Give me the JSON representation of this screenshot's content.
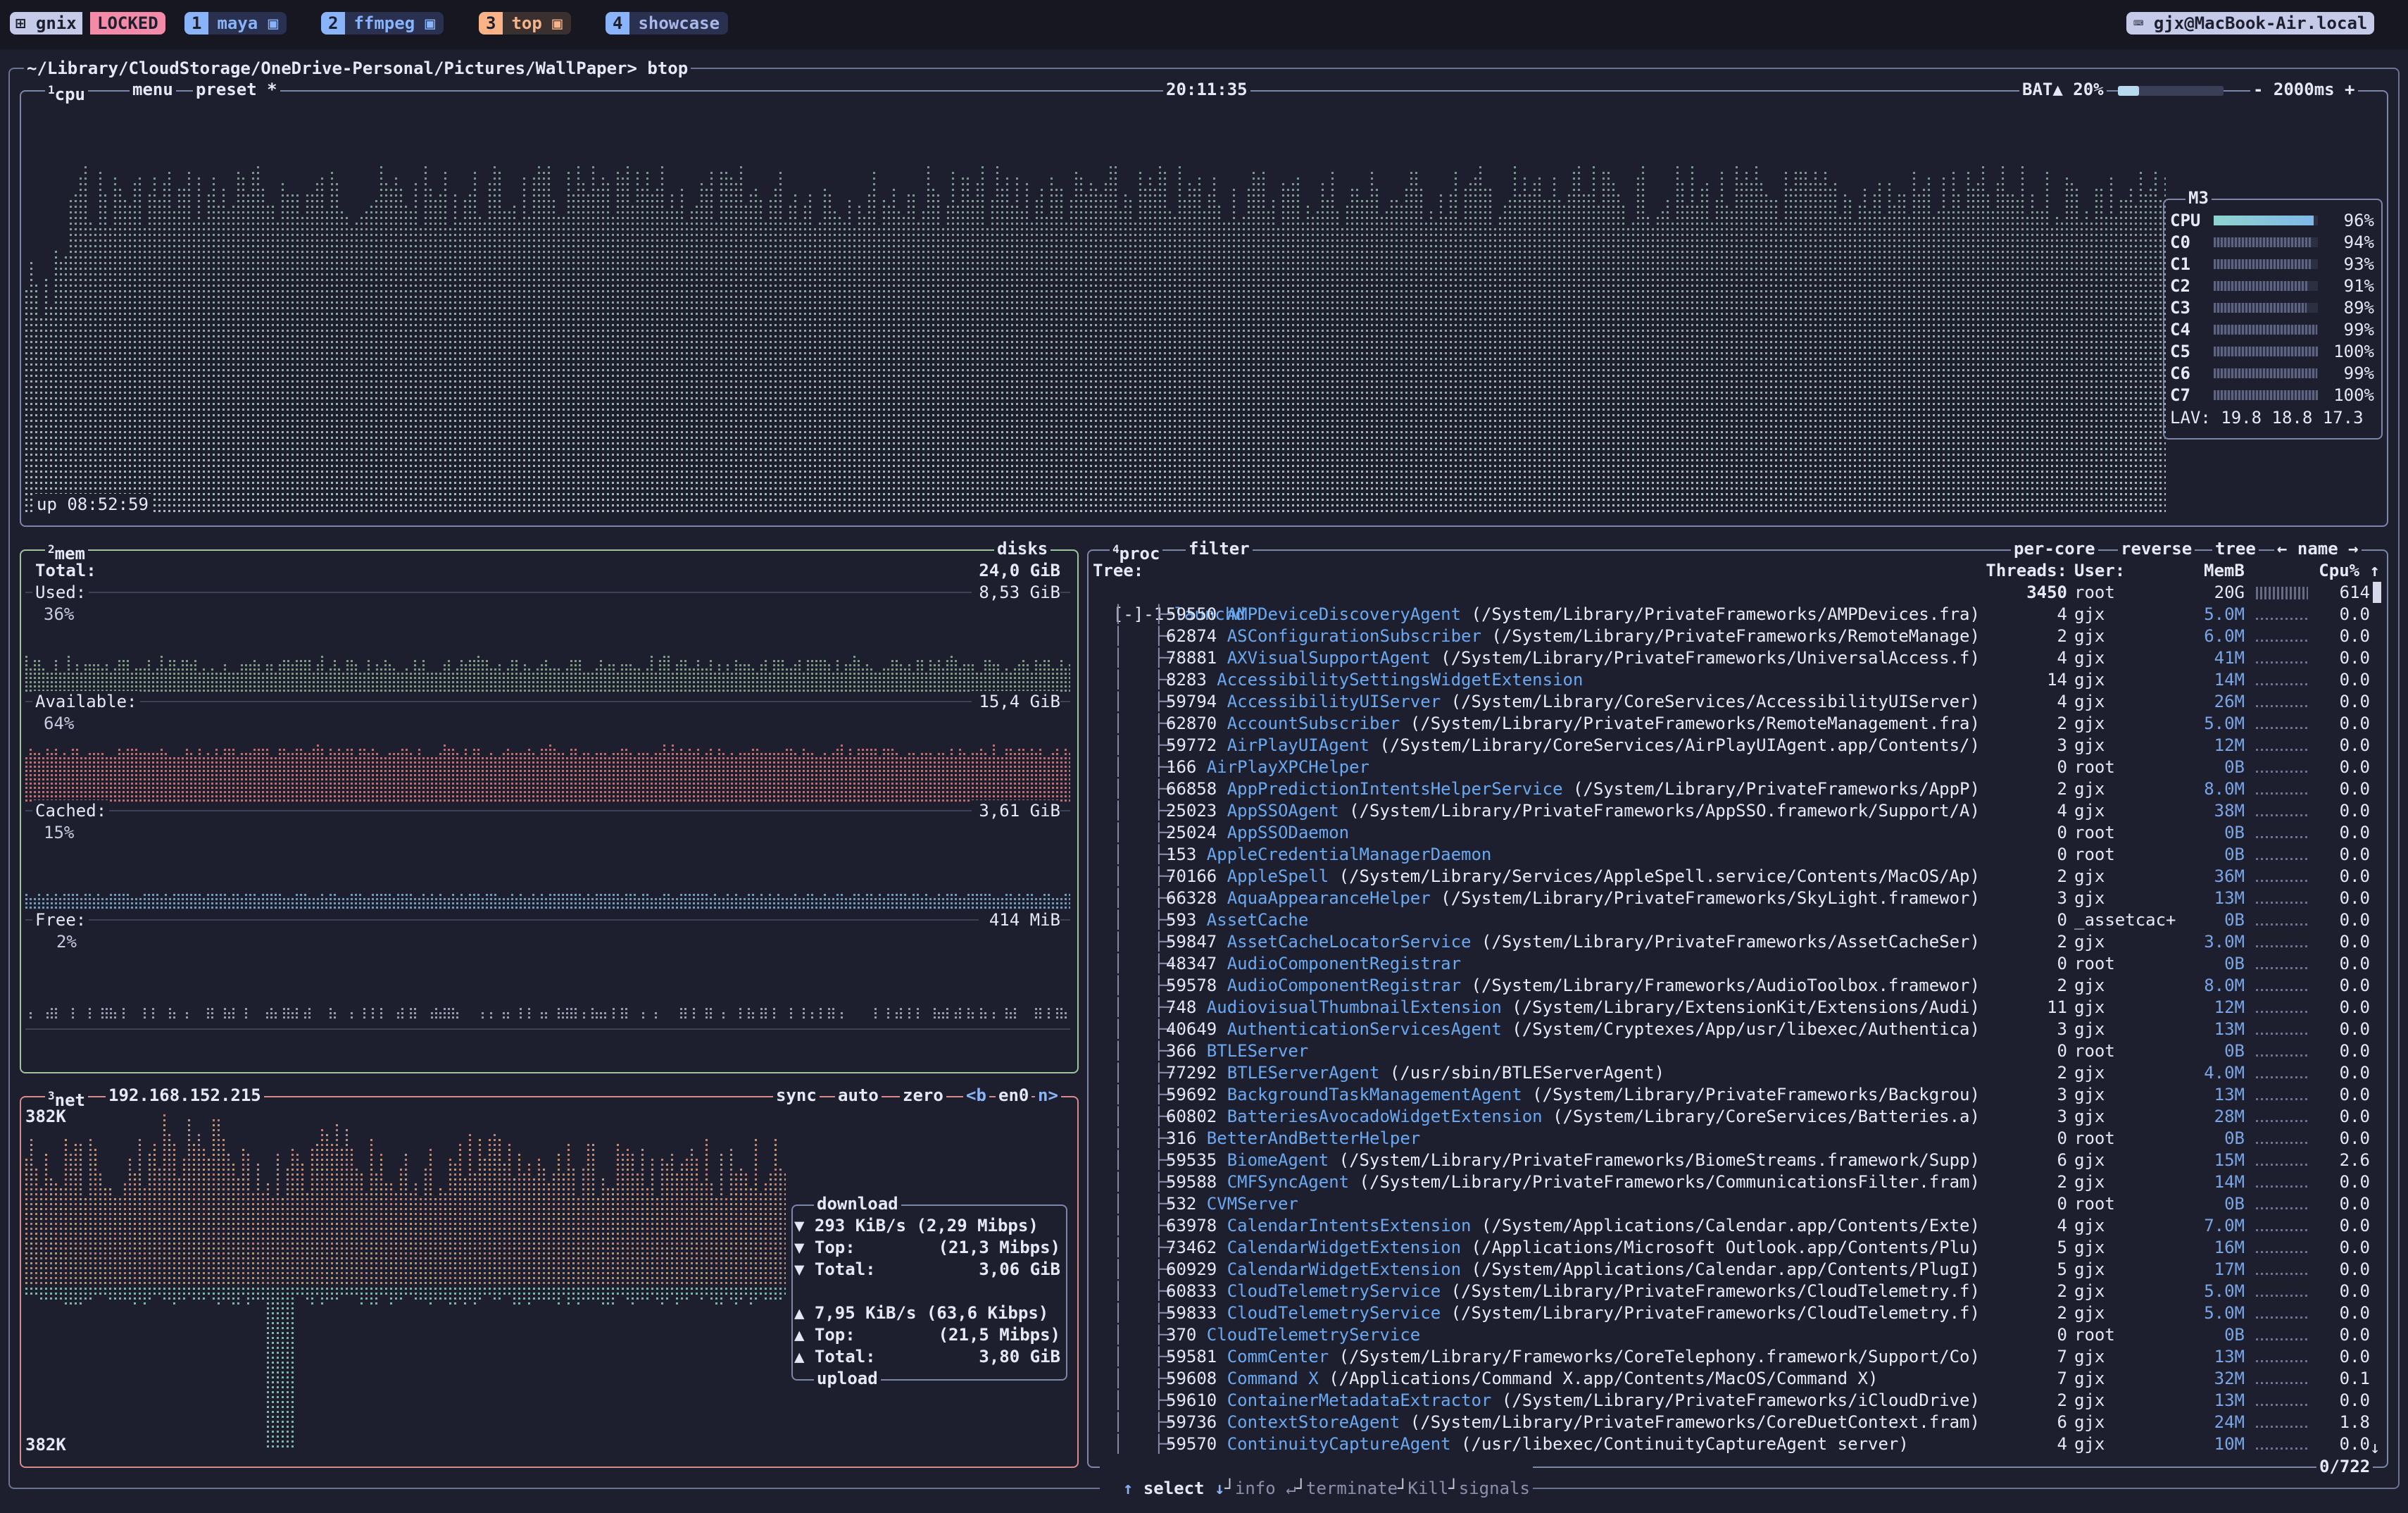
{
  "topbar": {
    "session_icon": "grid-icon",
    "session_name": "gnix",
    "session_status": "LOCKED",
    "windows": [
      {
        "index": "1",
        "name": "maya",
        "color": "#89b4fa"
      },
      {
        "index": "2",
        "name": "ffmpeg",
        "color": "#89b4fa"
      },
      {
        "index": "3",
        "name": "top",
        "color": "#fab387"
      },
      {
        "index": "4",
        "name": "showcase",
        "color": "#89b4fa"
      }
    ],
    "host": "gjx@MacBook-Air.local"
  },
  "prompt": "~/Library/CloudStorage/OneDrive-Personal/Pictures/WallPaper> btop",
  "cpu": {
    "pane_number": "1",
    "title": "cpu",
    "menu": "menu",
    "preset": "preset *",
    "clock": "20:11:35",
    "battery_label": "BAT▲ 20%",
    "battery_percent": 20,
    "refresh": "- 2000ms +",
    "uptime": "up 08:52:59",
    "model": "M3",
    "cores": [
      {
        "label": "CPU",
        "value": "96%",
        "level": 0.96
      },
      {
        "label": "C0",
        "value": "94%",
        "level": 0.94
      },
      {
        "label": "C1",
        "value": "93%",
        "level": 0.93
      },
      {
        "label": "C2",
        "value": "91%",
        "level": 0.91
      },
      {
        "label": "C3",
        "value": "89%",
        "level": 0.89
      },
      {
        "label": "C4",
        "value": "99%",
        "level": 0.99
      },
      {
        "label": "C5",
        "value": "100%",
        "level": 1.0
      },
      {
        "label": "C6",
        "value": "99%",
        "level": 0.99
      },
      {
        "label": "C7",
        "value": "100%",
        "level": 1.0
      }
    ],
    "load_avg": "LAV: 19.8 18.8 17.3"
  },
  "mem": {
    "pane_number": "2",
    "title": "mem",
    "disks": "disks",
    "total_label": "Total:",
    "total_value": "24,0 GiB",
    "used_label": "Used:",
    "used_value": "8,53 GiB",
    "used_pct": "36%",
    "available_label": "Available:",
    "available_value": "15,4 GiB",
    "available_pct": "64%",
    "cached_label": "Cached:",
    "cached_value": "3,61 GiB",
    "cached_pct": "15%",
    "free_label": "Free:",
    "free_value": "414 MiB",
    "free_pct": "2%"
  },
  "net": {
    "pane_number": "3",
    "title": "net",
    "ip": "192.168.152.215",
    "sync": "sync",
    "auto": "auto",
    "zero": "zero",
    "prev": "<b",
    "iface": "en0",
    "next": "n>",
    "scale_top": "382K",
    "scale_bottom": "382K",
    "download_title": "download",
    "download_rate": "▼ 293 KiB/s (2,29 Mibps)",
    "download_top_label": "▼ Top:",
    "download_top": "(21,3 Mibps)",
    "download_total_label": "▼ Total:",
    "download_total": "3,06 GiB",
    "upload_rate": "▲ 7,95 KiB/s (63,6 Kibps)",
    "upload_top_label": "▲ Top:",
    "upload_top": "(21,5 Mibps)",
    "upload_total_label": "▲ Total:",
    "upload_total": "3,80 GiB",
    "upload_title": "upload"
  },
  "proc": {
    "pane_number": "4",
    "title": "proc",
    "filter": "filter",
    "per_core": "per-core",
    "reverse": "reverse",
    "tree": "tree",
    "sort": "← name →",
    "col_tree": "Tree:",
    "col_threads": "Threads:",
    "col_user": "User:",
    "col_mem": "MemB",
    "col_cpu": "Cpu% ↑",
    "root": {
      "prefix": "[-]-1",
      "name": "launchd",
      "threads": "3450",
      "user": "root",
      "mem": "20G",
      "cpu": "614"
    },
    "rows": [
      {
        "pid": "59550",
        "name": "AMPDeviceDiscoveryAgent",
        "cmd": " (/System/Library/PrivateFrameworks/AMPDevices.fra)",
        "threads": "4",
        "user": "gjx",
        "mem": "5.0M",
        "cpu": "0.0"
      },
      {
        "pid": "62874",
        "name": "ASConfigurationSubscriber",
        "cmd": " (/System/Library/PrivateFrameworks/RemoteManage)",
        "threads": "2",
        "user": "gjx",
        "mem": "6.0M",
        "cpu": "0.0"
      },
      {
        "pid": "78881",
        "name": "AXVisualSupportAgent",
        "cmd": " (/System/Library/PrivateFrameworks/UniversalAccess.f)",
        "threads": "4",
        "user": "gjx",
        "mem": "41M",
        "cpu": "0.0"
      },
      {
        "pid": "8283",
        "name": "AccessibilitySettingsWidgetExtension",
        "cmd": "",
        "threads": "14",
        "user": "gjx",
        "mem": "14M",
        "cpu": "0.0"
      },
      {
        "pid": "59794",
        "name": "AccessibilityUIServer",
        "cmd": " (/System/Library/CoreServices/AccessibilityUIServer)",
        "threads": "4",
        "user": "gjx",
        "mem": "26M",
        "cpu": "0.0"
      },
      {
        "pid": "62870",
        "name": "AccountSubscriber",
        "cmd": " (/System/Library/PrivateFrameworks/RemoteManagement.fra)",
        "threads": "2",
        "user": "gjx",
        "mem": "5.0M",
        "cpu": "0.0"
      },
      {
        "pid": "59772",
        "name": "AirPlayUIAgent",
        "cmd": " (/System/Library/CoreServices/AirPlayUIAgent.app/Contents/)",
        "threads": "3",
        "user": "gjx",
        "mem": "12M",
        "cpu": "0.0"
      },
      {
        "pid": "166",
        "name": "AirPlayXPCHelper",
        "cmd": "",
        "threads": "0",
        "user": "root",
        "mem": "0B",
        "cpu": "0.0"
      },
      {
        "pid": "66858",
        "name": "AppPredictionIntentsHelperService",
        "cmd": " (/System/Library/PrivateFrameworks/AppP)",
        "threads": "2",
        "user": "gjx",
        "mem": "8.0M",
        "cpu": "0.0"
      },
      {
        "pid": "25023",
        "name": "AppSSOAgent",
        "cmd": " (/System/Library/PrivateFrameworks/AppSSO.framework/Support/A)",
        "threads": "4",
        "user": "gjx",
        "mem": "38M",
        "cpu": "0.0"
      },
      {
        "pid": "25024",
        "name": "AppSSODaemon",
        "cmd": "",
        "threads": "0",
        "user": "root",
        "mem": "0B",
        "cpu": "0.0"
      },
      {
        "pid": "153",
        "name": "AppleCredentialManagerDaemon",
        "cmd": "",
        "threads": "0",
        "user": "root",
        "mem": "0B",
        "cpu": "0.0"
      },
      {
        "pid": "70166",
        "name": "AppleSpell",
        "cmd": " (/System/Library/Services/AppleSpell.service/Contents/MacOS/Ap)",
        "threads": "2",
        "user": "gjx",
        "mem": "36M",
        "cpu": "0.0"
      },
      {
        "pid": "66328",
        "name": "AquaAppearanceHelper",
        "cmd": " (/System/Library/PrivateFrameworks/SkyLight.framewor)",
        "threads": "3",
        "user": "gjx",
        "mem": "13M",
        "cpu": "0.0"
      },
      {
        "pid": "593",
        "name": "AssetCache",
        "cmd": "",
        "threads": "0",
        "user": "_assetcac+",
        "mem": "0B",
        "cpu": "0.0"
      },
      {
        "pid": "59847",
        "name": "AssetCacheLocatorService",
        "cmd": " (/System/Library/PrivateFrameworks/AssetCacheSer)",
        "threads": "2",
        "user": "gjx",
        "mem": "3.0M",
        "cpu": "0.0"
      },
      {
        "pid": "48347",
        "name": "AudioComponentRegistrar",
        "cmd": "",
        "threads": "0",
        "user": "root",
        "mem": "0B",
        "cpu": "0.0"
      },
      {
        "pid": "59578",
        "name": "AudioComponentRegistrar",
        "cmd": " (/System/Library/Frameworks/AudioToolbox.framewor)",
        "threads": "2",
        "user": "gjx",
        "mem": "8.0M",
        "cpu": "0.0"
      },
      {
        "pid": "748",
        "name": "AudiovisualThumbnailExtension",
        "cmd": " (/System/Library/ExtensionKit/Extensions/Audi)",
        "threads": "11",
        "user": "gjx",
        "mem": "12M",
        "cpu": "0.0"
      },
      {
        "pid": "40649",
        "name": "AuthenticationServicesAgent",
        "cmd": " (/System/Cryptexes/App/usr/libexec/Authentica)",
        "threads": "3",
        "user": "gjx",
        "mem": "13M",
        "cpu": "0.0"
      },
      {
        "pid": "366",
        "name": "BTLEServer",
        "cmd": "",
        "threads": "0",
        "user": "root",
        "mem": "0B",
        "cpu": "0.0"
      },
      {
        "pid": "77292",
        "name": "BTLEServerAgent",
        "cmd": " (/usr/sbin/BTLEServerAgent)",
        "threads": "2",
        "user": "gjx",
        "mem": "4.0M",
        "cpu": "0.0"
      },
      {
        "pid": "59692",
        "name": "BackgroundTaskManagementAgent",
        "cmd": " (/System/Library/PrivateFrameworks/Backgrou)",
        "threads": "3",
        "user": "gjx",
        "mem": "13M",
        "cpu": "0.0"
      },
      {
        "pid": "60802",
        "name": "BatteriesAvocadoWidgetExtension",
        "cmd": " (/System/Library/CoreServices/Batteries.a)",
        "threads": "3",
        "user": "gjx",
        "mem": "28M",
        "cpu": "0.0"
      },
      {
        "pid": "316",
        "name": "BetterAndBetterHelper",
        "cmd": "",
        "threads": "0",
        "user": "root",
        "mem": "0B",
        "cpu": "0.0"
      },
      {
        "pid": "59535",
        "name": "BiomeAgent",
        "cmd": " (/System/Library/PrivateFrameworks/BiomeStreams.framework/Supp)",
        "threads": "6",
        "user": "gjx",
        "mem": "15M",
        "cpu": "2.6"
      },
      {
        "pid": "59588",
        "name": "CMFSyncAgent",
        "cmd": " (/System/Library/PrivateFrameworks/CommunicationsFilter.fram)",
        "threads": "2",
        "user": "gjx",
        "mem": "14M",
        "cpu": "0.0"
      },
      {
        "pid": "532",
        "name": "CVMServer",
        "cmd": "",
        "threads": "0",
        "user": "root",
        "mem": "0B",
        "cpu": "0.0"
      },
      {
        "pid": "63978",
        "name": "CalendarIntentsExtension",
        "cmd": " (/System/Applications/Calendar.app/Contents/Exte)",
        "threads": "4",
        "user": "gjx",
        "mem": "7.0M",
        "cpu": "0.0"
      },
      {
        "pid": "73462",
        "name": "CalendarWidgetExtension",
        "cmd": " (/Applications/Microsoft Outlook.app/Contents/Plu)",
        "threads": "5",
        "user": "gjx",
        "mem": "16M",
        "cpu": "0.0"
      },
      {
        "pid": "60929",
        "name": "CalendarWidgetExtension",
        "cmd": " (/System/Applications/Calendar.app/Contents/PlugI)",
        "threads": "5",
        "user": "gjx",
        "mem": "17M",
        "cpu": "0.0"
      },
      {
        "pid": "60833",
        "name": "CloudTelemetryService",
        "cmd": " (/System/Library/PrivateFrameworks/CloudTelemetry.f)",
        "threads": "2",
        "user": "gjx",
        "mem": "5.0M",
        "cpu": "0.0"
      },
      {
        "pid": "59833",
        "name": "CloudTelemetryService",
        "cmd": " (/System/Library/PrivateFrameworks/CloudTelemetry.f)",
        "threads": "2",
        "user": "gjx",
        "mem": "5.0M",
        "cpu": "0.0"
      },
      {
        "pid": "370",
        "name": "CloudTelemetryService",
        "cmd": "",
        "threads": "0",
        "user": "root",
        "mem": "0B",
        "cpu": "0.0"
      },
      {
        "pid": "59581",
        "name": "CommCenter",
        "cmd": " (/System/Library/Frameworks/CoreTelephony.framework/Support/Co)",
        "threads": "7",
        "user": "gjx",
        "mem": "13M",
        "cpu": "0.0"
      },
      {
        "pid": "59608",
        "name": "Command X",
        "cmd": " (/Applications/Command X.app/Contents/MacOS/Command X)",
        "threads": "7",
        "user": "gjx",
        "mem": "32M",
        "cpu": "0.1"
      },
      {
        "pid": "59610",
        "name": "ContainerMetadataExtractor",
        "cmd": " (/System/Library/PrivateFrameworks/iCloudDrive)",
        "threads": "2",
        "user": "gjx",
        "mem": "13M",
        "cpu": "0.0"
      },
      {
        "pid": "59736",
        "name": "ContextStoreAgent",
        "cmd": " (/System/Library/PrivateFrameworks/CoreDuetContext.fram)",
        "threads": "6",
        "user": "gjx",
        "mem": "24M",
        "cpu": "1.8"
      },
      {
        "pid": "59570",
        "name": "ContinuityCaptureAgent",
        "cmd": " (/usr/libexec/ContinuityCaptureAgent server)",
        "threads": "4",
        "user": "gjx",
        "mem": "10M",
        "cpu": "0.0"
      }
    ],
    "footer_up": "↑",
    "footer_select": "select",
    "footer_down": "↓",
    "footer_info": "info",
    "footer_enter": "↵",
    "footer_terminate": "terminate",
    "footer_kill": "Kill",
    "footer_signals": "signals",
    "count": "0/722"
  },
  "colors": {
    "background": "#1e1f2e",
    "border": "#7d86a8",
    "accent_teal": "#8fd3cf",
    "mem_used": "#9bb6a0",
    "mem_available": "#d98a8a",
    "mem_cached": "#8fb9d9",
    "net_download": "#e0918a",
    "net_upload": "#8fd3bf",
    "locked_pill": "#f38ba8"
  }
}
